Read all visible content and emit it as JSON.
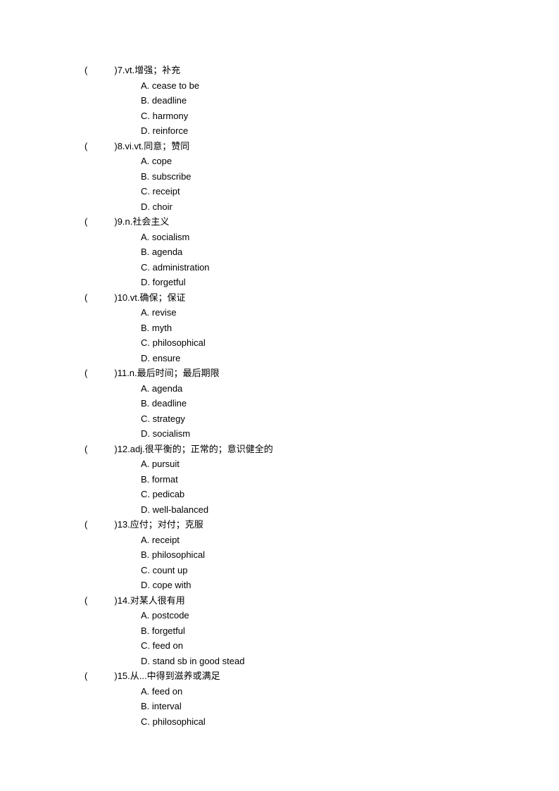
{
  "questions": [
    {
      "number": "7",
      "prompt": ".vt.增强；补充",
      "options": [
        "A. cease to be",
        "B. deadline",
        "C. harmony",
        "D. reinforce"
      ]
    },
    {
      "number": "8",
      "prompt": ".vi.vt.同意；赞同",
      "options": [
        "A. cope",
        "B. subscribe",
        "C. receipt",
        "D. choir"
      ]
    },
    {
      "number": "9",
      "prompt": ".n.社会主义",
      "options": [
        "A. socialism",
        "B. agenda",
        "C. administration",
        "D. forgetful"
      ]
    },
    {
      "number": "10",
      "prompt": ".vt.确保；保证",
      "options": [
        "A. revise",
        "B. myth",
        "C. philosophical",
        "D. ensure"
      ]
    },
    {
      "number": "11",
      "prompt": ".n.最后时间；最后期限",
      "options": [
        "A. agenda",
        "B. deadline",
        "C. strategy",
        "D. socialism"
      ]
    },
    {
      "number": "12",
      "prompt": ".adj.很平衡的；正常的；意识健全的",
      "options": [
        "A. pursuit",
        "B. format",
        "C. pedicab",
        "D. well-balanced"
      ]
    },
    {
      "number": "13",
      "prompt": ".应付；对付；克服",
      "options": [
        "A. receipt",
        "B. philosophical",
        "C. count up",
        "D. cope with"
      ]
    },
    {
      "number": "14",
      "prompt": ".对某人很有用",
      "options": [
        "A. postcode",
        "B. forgetful",
        "C. feed on",
        "D. stand sb in good stead"
      ]
    },
    {
      "number": "15",
      "prompt": ".从...中得到滋养或满足",
      "options": [
        "A. feed on",
        "B. interval",
        "C. philosophical"
      ]
    }
  ],
  "paren_open": "(",
  "paren_close": ")"
}
